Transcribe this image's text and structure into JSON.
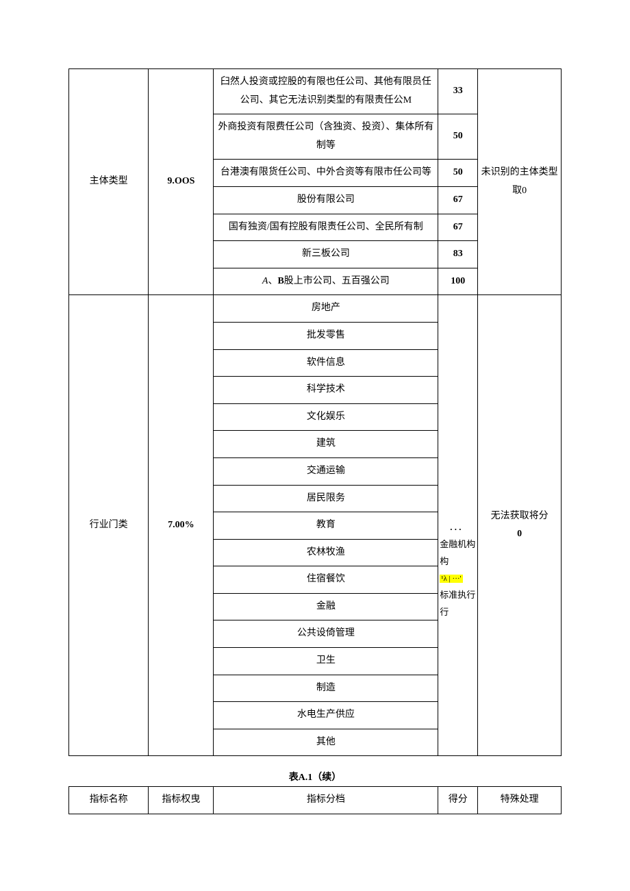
{
  "section1": {
    "name": "主体类型",
    "weight": "9.OOS",
    "special": "未识别的主体类型取0",
    "rows": [
      {
        "tier": "臼然人投资或控股的有限也任公司、其他有限员任公司、其它无法识别类型的有限责任公M",
        "score": "33",
        "scoreBold": true
      },
      {
        "tier": "外商投资有限费任公司（含独资、投资）、集体所有制等",
        "score": "50",
        "scoreBold": true
      },
      {
        "tier": "台港澳有限货任公司、中外合资等有限市任公司等",
        "score": "50",
        "scoreBold": true
      },
      {
        "tier": "股份有限公司",
        "score": "67",
        "scoreBold": true
      },
      {
        "tier": "国有独资/国有控股有限责任公司、全民所有制",
        "score": "67",
        "scoreBold": true
      },
      {
        "tier": "新三板公司",
        "score": "83",
        "scoreBold": true
      },
      {
        "tier": "A、B股上市公司、五百强公司",
        "score": "100",
        "scoreBold": true,
        "tierItalicA": true
      }
    ]
  },
  "section2": {
    "name": "行业门类",
    "weight": "7.00%",
    "scoreNote": {
      "line1": "．．．",
      "line2": "金融机构",
      "hl": "¹λ | ···'",
      "line3": "标准执行"
    },
    "special": {
      "line1": "无法获取将分",
      "line2": "0"
    },
    "rows": [
      "房地产",
      "批发零售",
      "软件信息",
      "科学技术",
      "文化娱乐",
      "建筑",
      "交通运输",
      "居民限务",
      "教育",
      "农林牧渔",
      "住宿餐饮",
      "金融",
      "公共设倚管理",
      "卫生",
      "制造",
      "水电生产供应",
      "其他"
    ]
  },
  "caption": "表A.1（续）",
  "header": {
    "c1": "指标名称",
    "c2": "指标权曳",
    "c3": "指标分档",
    "c4": "得分",
    "c5": "特殊处理"
  }
}
